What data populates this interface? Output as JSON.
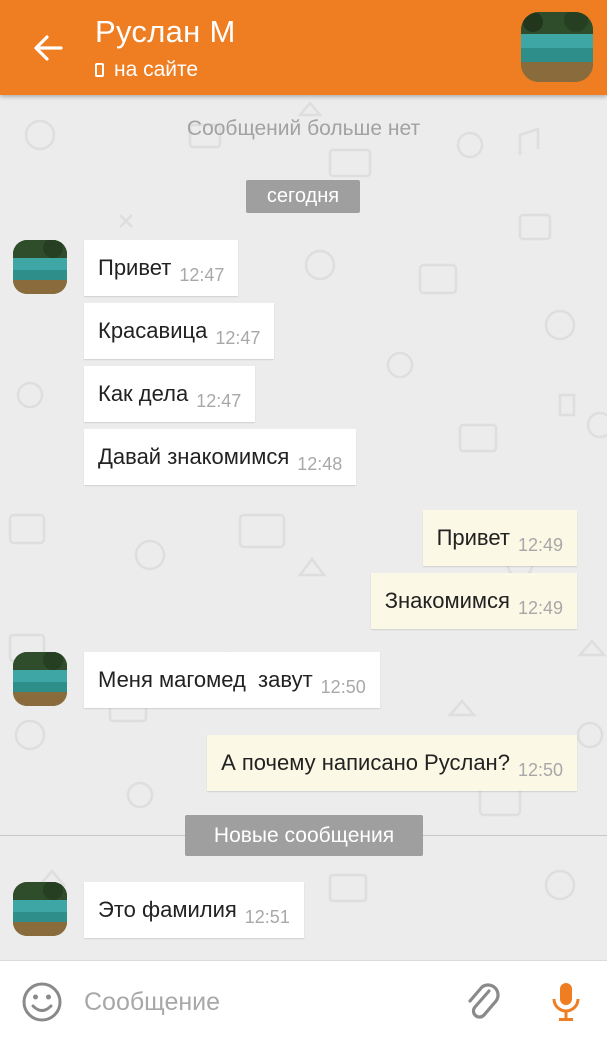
{
  "header": {
    "title": "Руслан М",
    "status": "на сайте",
    "accent_color": "#ef7d21",
    "back_icon": "arrow-left-icon",
    "status_icon": "phone-icon"
  },
  "chat": {
    "no_more_messages": "Сообщений больше нет",
    "date_separator": "сегодня",
    "new_messages_separator": "Новые сообщения",
    "messages": [
      {
        "dir": "in",
        "text": "Привет",
        "time": "12:47"
      },
      {
        "dir": "in",
        "text": "Красавица",
        "time": "12:47"
      },
      {
        "dir": "in",
        "text": "Как дела",
        "time": "12:47"
      },
      {
        "dir": "in",
        "text": "Давай знакомимся",
        "time": "12:48"
      },
      {
        "dir": "out",
        "text": "Привет",
        "time": "12:49"
      },
      {
        "dir": "out",
        "text": "Знакомимся",
        "time": "12:49"
      },
      {
        "dir": "in",
        "text": "Меня магомед  завут",
        "time": "12:50"
      },
      {
        "dir": "out",
        "text": "А почему написано Руслан?",
        "time": "12:50"
      },
      {
        "dir": "in",
        "text": "Это фамилия",
        "time": "12:51"
      }
    ]
  },
  "input": {
    "placeholder": "Сообщение",
    "emoji_icon": "smiley-icon",
    "attach_icon": "paperclip-icon",
    "mic_icon": "microphone-icon"
  }
}
